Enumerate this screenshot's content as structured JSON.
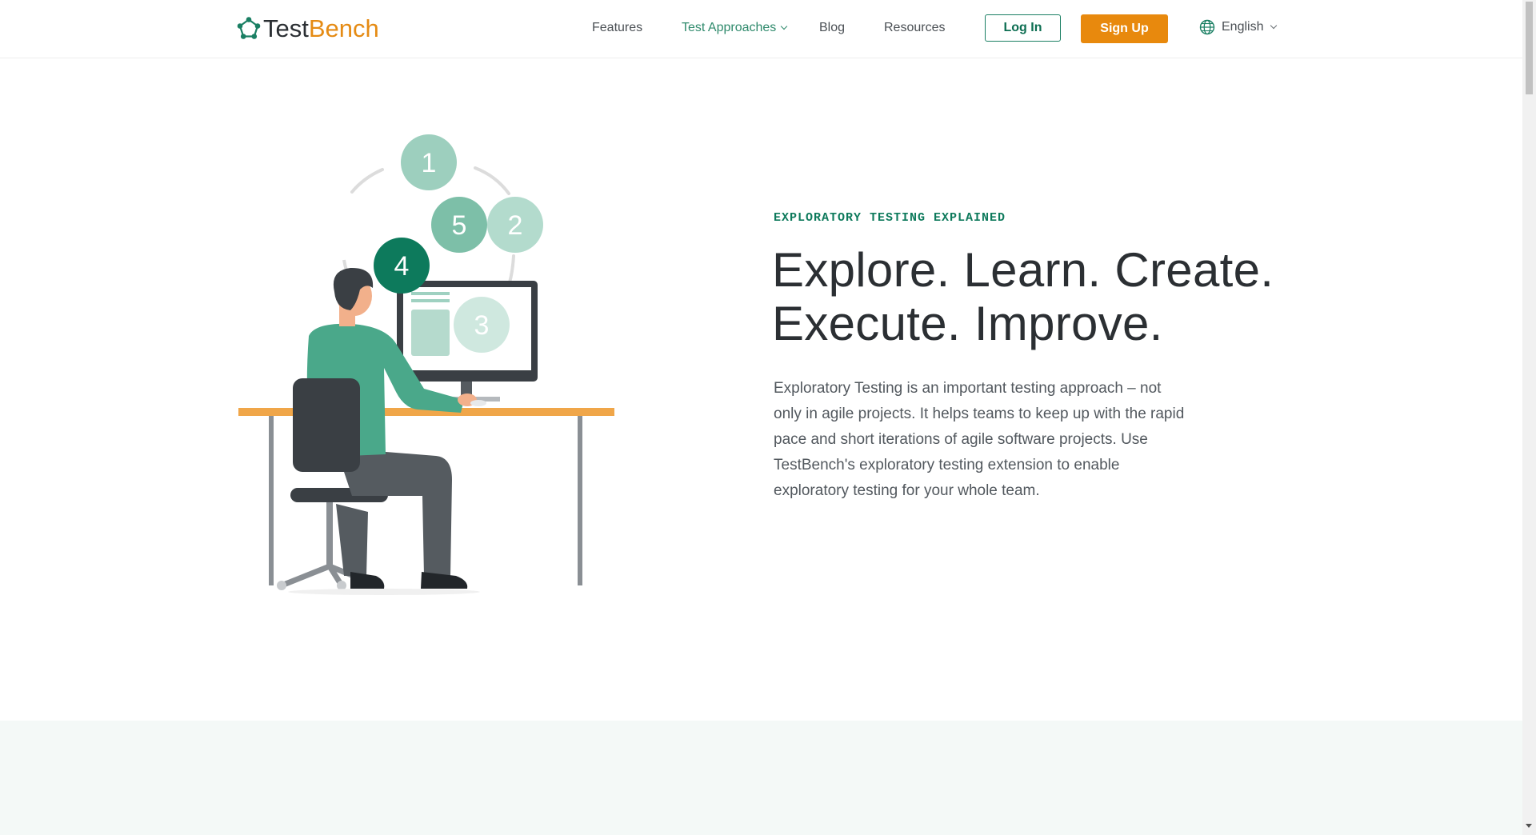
{
  "brand": {
    "logo_part1": "Test",
    "logo_part2": "Bench",
    "accent_color": "#e8890d",
    "primary_color": "#0e7a5c"
  },
  "nav": {
    "features": "Features",
    "test_approaches": "Test Approaches",
    "blog": "Blog",
    "resources": "Resources",
    "login": "Log In",
    "signup": "Sign Up",
    "language": "English"
  },
  "hero": {
    "eyebrow": "EXPLORATORY TESTING EXPLAINED",
    "headline_line1": "Explore. Learn. Create.",
    "headline_line2": "Execute. Improve.",
    "body": "Exploratory Testing is an important testing approach – not only in agile projects. It helps teams to keep up with the rapid pace and short iterations of agile software projects. Use TestBench's exploratory testing extension to enable exploratory testing for your whole team."
  },
  "illustration": {
    "cycle_steps": [
      "1",
      "2",
      "3",
      "4",
      "5"
    ],
    "active_step": "4"
  }
}
